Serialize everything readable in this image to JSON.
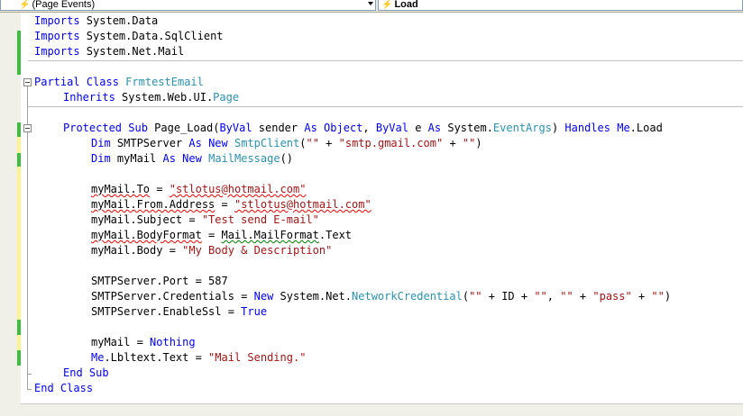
{
  "toolbar": {
    "object_dropdown": "(Page Events)",
    "method_dropdown": "Load"
  },
  "code": {
    "l1": [
      "Imports",
      " System.Data"
    ],
    "l2": [
      "Imports",
      " System.Data.SqlClient"
    ],
    "l3": [
      "Imports",
      " System.Net.Mail"
    ],
    "l4": [
      "Partial",
      " ",
      "Class",
      " ",
      "FrmtestEmail"
    ],
    "l5": [
      "Inherits",
      " System.Web.UI.",
      "Page"
    ],
    "l6": [
      "Protected",
      " ",
      "Sub",
      " Page_Load(",
      "ByVal",
      " sender ",
      "As",
      " ",
      "Object",
      ", ",
      "ByVal",
      " e ",
      "As",
      " System.",
      "EventArgs",
      ") ",
      "Handles",
      " ",
      "Me",
      ".Load"
    ],
    "l7": [
      "Dim",
      " SMTPServer ",
      "As",
      " ",
      "New",
      " ",
      "SmtpClient",
      "(",
      "\"\"",
      " + ",
      "\"smtp.gmail.com\"",
      " + ",
      "\"\"",
      ")"
    ],
    "l8": [
      "Dim",
      " myMail ",
      "As",
      " ",
      "New",
      " ",
      "MailMessage",
      "()"
    ],
    "l9": [
      "myMail.To",
      " = ",
      "\"stlotus@hotmail.com\""
    ],
    "l10": [
      "myMail.From.Address",
      " = ",
      "\"stlotus@hotmail.com\""
    ],
    "l11": [
      "myMail.Subject = ",
      "\"Test send E-mail\""
    ],
    "l12": [
      "myMail.BodyFormat",
      " = ",
      "Mail.MailFormat",
      ".Text"
    ],
    "l13": [
      "myMail.Body = ",
      "\"My Body & Description\""
    ],
    "l14": [
      "SMTPServer.Port = 587"
    ],
    "l15": [
      "SMTPServer.Credentials = ",
      "New",
      " System.Net.",
      "NetworkCredential",
      "(",
      "\"\"",
      " + ID + ",
      "\"\"",
      ", ",
      "\"\"",
      " + ",
      "\"pass\"",
      " + ",
      "\"\"",
      ")"
    ],
    "l16": [
      "SMTPServer.EnableSsl = ",
      "True"
    ],
    "l17": [
      "myMail = ",
      "Nothing"
    ],
    "l18": [
      "Me",
      ".Lbltext.Text = ",
      "\"Mail Sending.\""
    ],
    "l19": [
      "End",
      " ",
      "Sub"
    ],
    "l20": [
      "End",
      " ",
      "Class"
    ]
  },
  "colors": {
    "keyword": "#0000ff",
    "type": "#2b91af",
    "string": "#a31515",
    "change_saved": "#3fbf3f",
    "change_unsaved": "#fcf392"
  }
}
